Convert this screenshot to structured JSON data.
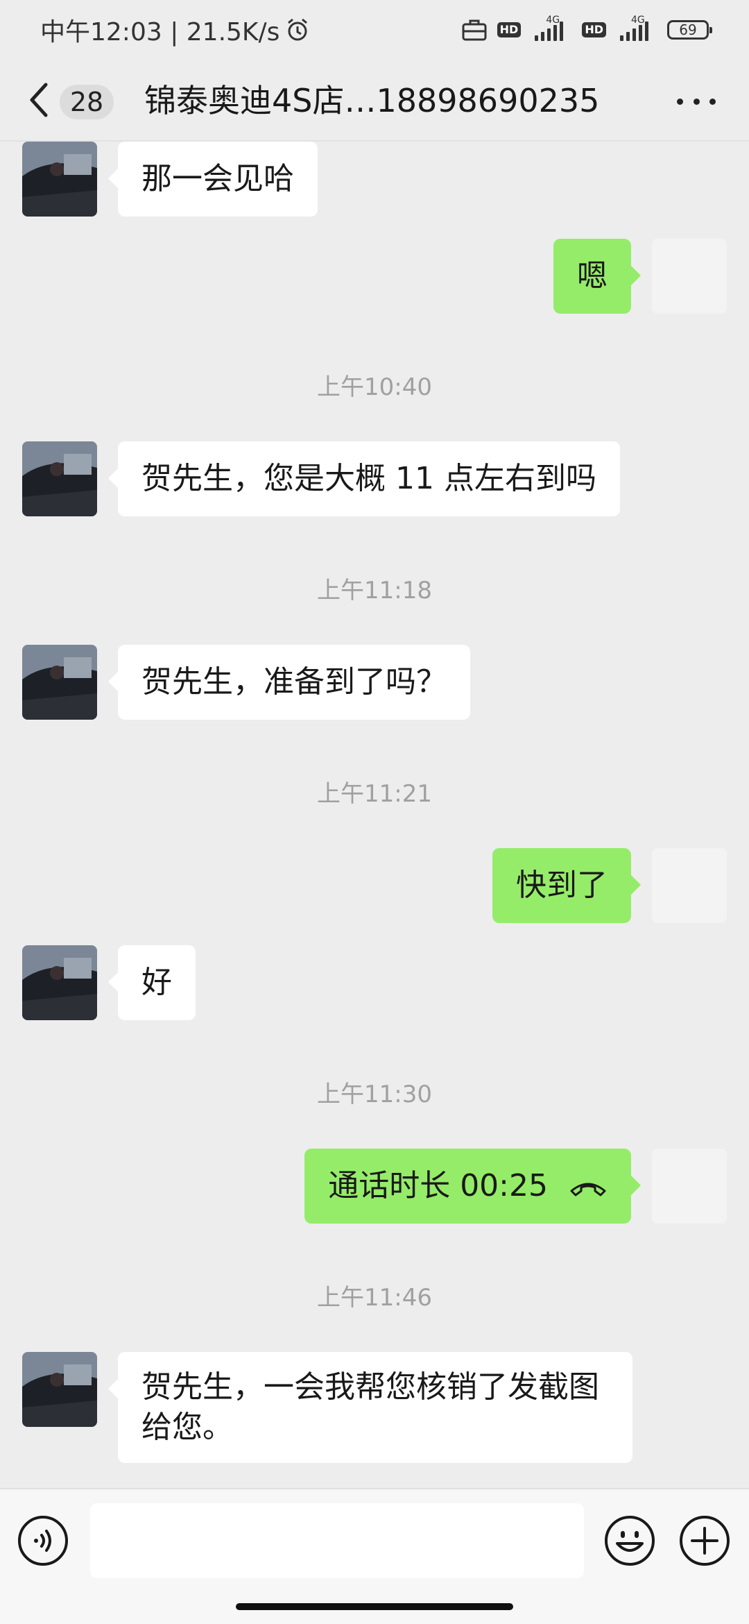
{
  "status_bar": {
    "time_speed": "中午12:03 | 21.5K/s",
    "hd1": "HD",
    "net1": "4G",
    "hd2": "HD",
    "net2": "4G",
    "battery": "69",
    "icons": [
      "alarm-icon",
      "briefcase-icon",
      "signal-icon",
      "battery-icon"
    ]
  },
  "header": {
    "unread_count": "28",
    "title": "锦泰奥迪4S店…18898690235",
    "icons": [
      "back-icon",
      "more-icon"
    ]
  },
  "messages": [
    {
      "type": "in",
      "text": "那一会见哈"
    },
    {
      "type": "out",
      "text": "嗯"
    },
    {
      "type": "time",
      "text": "上午10:40"
    },
    {
      "type": "in",
      "text": "贺先生，您是大概 11 点左右到吗"
    },
    {
      "type": "time",
      "text": "上午11:18"
    },
    {
      "type": "in",
      "text": "贺先生，准备到了吗？"
    },
    {
      "type": "time",
      "text": "上午11:21"
    },
    {
      "type": "out",
      "text": "快到了"
    },
    {
      "type": "in",
      "text": "好"
    },
    {
      "type": "time",
      "text": "上午11:30"
    },
    {
      "type": "out-call",
      "text": "通话时长 00:25"
    },
    {
      "type": "time",
      "text": "上午11:46"
    },
    {
      "type": "in",
      "text": "贺先生，一会我帮您核销了发截图给您。"
    }
  ],
  "input_bar": {
    "value": "",
    "icons": [
      "voice-icon",
      "emoji-icon",
      "plus-icon"
    ]
  },
  "colors": {
    "background": "#ededed",
    "outgoing_bubble": "#95ec69",
    "incoming_bubble": "#ffffff",
    "timestamp": "#a0a0a0"
  }
}
